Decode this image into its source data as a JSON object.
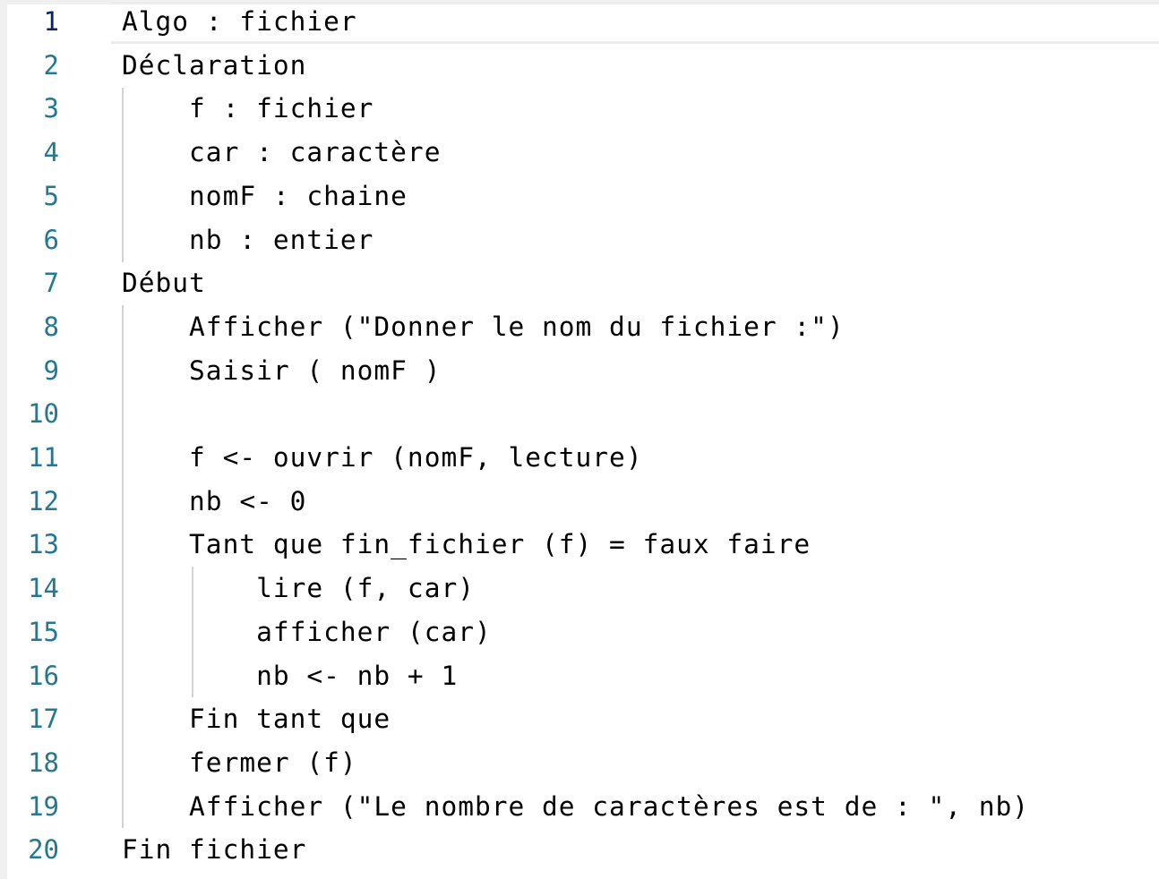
{
  "editor": {
    "lines": [
      {
        "number": "1",
        "text": "Algo : fichier"
      },
      {
        "number": "2",
        "text": "Déclaration"
      },
      {
        "number": "3",
        "text": "    f : fichier"
      },
      {
        "number": "4",
        "text": "    car : caractère"
      },
      {
        "number": "5",
        "text": "    nomF : chaine"
      },
      {
        "number": "6",
        "text": "    nb : entier"
      },
      {
        "number": "7",
        "text": "Début"
      },
      {
        "number": "8",
        "text": "    Afficher (\"Donner le nom du fichier :\")"
      },
      {
        "number": "9",
        "text": "    Saisir ( nomF )"
      },
      {
        "number": "10",
        "text": ""
      },
      {
        "number": "11",
        "text": "    f <- ouvrir (nomF, lecture)"
      },
      {
        "number": "12",
        "text": "    nb <- 0"
      },
      {
        "number": "13",
        "text": "    Tant que fin_fichier (f) = faux faire"
      },
      {
        "number": "14",
        "text": "        lire (f, car)"
      },
      {
        "number": "15",
        "text": "        afficher (car)"
      },
      {
        "number": "16",
        "text": "        nb <- nb + 1"
      },
      {
        "number": "17",
        "text": "    Fin tant que"
      },
      {
        "number": "18",
        "text": "    fermer (f)"
      },
      {
        "number": "19",
        "text": "    Afficher (\"Le nombre de caractères est de : \", nb)"
      },
      {
        "number": "20",
        "text": "Fin fichier"
      }
    ],
    "active_line": "1",
    "colors": {
      "line_number": "#237893",
      "active_line_number": "#0b216f",
      "text": "#000000",
      "indent_guide": "#d3d3d3",
      "current_line_border": "#ececec"
    }
  }
}
